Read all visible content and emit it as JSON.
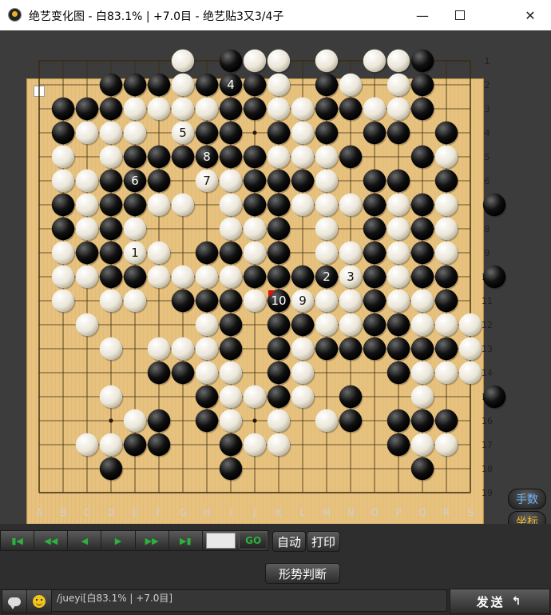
{
  "window": {
    "title": "绝艺变化图 - 白83.1% | +7.0目 - 绝艺贴3又3/4子",
    "minimize_glyph": "—",
    "close_glyph": "✕"
  },
  "board": {
    "size": 19,
    "col_labels": [
      "A",
      "B",
      "C",
      "D",
      "E",
      "F",
      "G",
      "H",
      "I",
      "J",
      "K",
      "L",
      "M",
      "N",
      "O",
      "P",
      "Q",
      "R",
      "S"
    ],
    "row_labels": [
      "1",
      "2",
      "3",
      "4",
      "5",
      "6",
      "7",
      "8",
      "9",
      "10",
      "11",
      "12",
      "13",
      "14",
      "15",
      "16",
      "17",
      "18",
      "19"
    ],
    "stones": [
      {
        "c": "w",
        "x": 6,
        "y": 0
      },
      {
        "c": "b",
        "x": 8,
        "y": 0
      },
      {
        "c": "w",
        "x": 9,
        "y": 0
      },
      {
        "c": "w",
        "x": 10,
        "y": 0
      },
      {
        "c": "w",
        "x": 12,
        "y": 0
      },
      {
        "c": "w",
        "x": 14,
        "y": 0
      },
      {
        "c": "w",
        "x": 15,
        "y": 0
      },
      {
        "c": "b",
        "x": 16,
        "y": 0
      },
      {
        "c": "b",
        "x": 3,
        "y": 1
      },
      {
        "c": "b",
        "x": 4,
        "y": 1
      },
      {
        "c": "b",
        "x": 5,
        "y": 1
      },
      {
        "c": "w",
        "x": 6,
        "y": 1
      },
      {
        "c": "b",
        "x": 7,
        "y": 1
      },
      {
        "c": "b",
        "x": 8,
        "y": 1,
        "n": "4"
      },
      {
        "c": "b",
        "x": 9,
        "y": 1
      },
      {
        "c": "w",
        "x": 10,
        "y": 1
      },
      {
        "c": "b",
        "x": 12,
        "y": 1
      },
      {
        "c": "w",
        "x": 13,
        "y": 1
      },
      {
        "c": "w",
        "x": 15,
        "y": 1
      },
      {
        "c": "b",
        "x": 16,
        "y": 1
      },
      {
        "c": "b",
        "x": 1,
        "y": 2
      },
      {
        "c": "b",
        "x": 2,
        "y": 2
      },
      {
        "c": "b",
        "x": 3,
        "y": 2
      },
      {
        "c": "w",
        "x": 4,
        "y": 2
      },
      {
        "c": "w",
        "x": 5,
        "y": 2
      },
      {
        "c": "w",
        "x": 6,
        "y": 2
      },
      {
        "c": "w",
        "x": 7,
        "y": 2
      },
      {
        "c": "b",
        "x": 8,
        "y": 2
      },
      {
        "c": "b",
        "x": 9,
        "y": 2
      },
      {
        "c": "w",
        "x": 10,
        "y": 2
      },
      {
        "c": "w",
        "x": 11,
        "y": 2
      },
      {
        "c": "b",
        "x": 12,
        "y": 2
      },
      {
        "c": "b",
        "x": 13,
        "y": 2
      },
      {
        "c": "w",
        "x": 14,
        "y": 2
      },
      {
        "c": "w",
        "x": 15,
        "y": 2
      },
      {
        "c": "b",
        "x": 16,
        "y": 2
      },
      {
        "c": "b",
        "x": 1,
        "y": 3
      },
      {
        "c": "w",
        "x": 2,
        "y": 3
      },
      {
        "c": "w",
        "x": 3,
        "y": 3
      },
      {
        "c": "w",
        "x": 4,
        "y": 3
      },
      {
        "c": "w",
        "x": 6,
        "y": 3,
        "n": "5"
      },
      {
        "c": "b",
        "x": 7,
        "y": 3
      },
      {
        "c": "b",
        "x": 8,
        "y": 3
      },
      {
        "c": "b",
        "x": 10,
        "y": 3
      },
      {
        "c": "w",
        "x": 11,
        "y": 3
      },
      {
        "c": "b",
        "x": 12,
        "y": 3
      },
      {
        "c": "b",
        "x": 14,
        "y": 3
      },
      {
        "c": "b",
        "x": 15,
        "y": 3
      },
      {
        "c": "b",
        "x": 17,
        "y": 3
      },
      {
        "c": "w",
        "x": 1,
        "y": 4
      },
      {
        "c": "w",
        "x": 3,
        "y": 4
      },
      {
        "c": "b",
        "x": 4,
        "y": 4
      },
      {
        "c": "b",
        "x": 5,
        "y": 4
      },
      {
        "c": "b",
        "x": 6,
        "y": 4
      },
      {
        "c": "b",
        "x": 7,
        "y": 4,
        "n": "8"
      },
      {
        "c": "b",
        "x": 8,
        "y": 4
      },
      {
        "c": "b",
        "x": 9,
        "y": 4
      },
      {
        "c": "w",
        "x": 10,
        "y": 4
      },
      {
        "c": "w",
        "x": 11,
        "y": 4
      },
      {
        "c": "w",
        "x": 12,
        "y": 4
      },
      {
        "c": "b",
        "x": 13,
        "y": 4
      },
      {
        "c": "b",
        "x": 16,
        "y": 4
      },
      {
        "c": "w",
        "x": 17,
        "y": 4
      },
      {
        "c": "w",
        "x": 1,
        "y": 5
      },
      {
        "c": "w",
        "x": 2,
        "y": 5
      },
      {
        "c": "b",
        "x": 3,
        "y": 5
      },
      {
        "c": "b",
        "x": 4,
        "y": 5,
        "n": "6"
      },
      {
        "c": "b",
        "x": 5,
        "y": 5
      },
      {
        "c": "w",
        "x": 7,
        "y": 5,
        "n": "7"
      },
      {
        "c": "w",
        "x": 8,
        "y": 5
      },
      {
        "c": "b",
        "x": 9,
        "y": 5
      },
      {
        "c": "b",
        "x": 10,
        "y": 5
      },
      {
        "c": "b",
        "x": 11,
        "y": 5
      },
      {
        "c": "w",
        "x": 12,
        "y": 5
      },
      {
        "c": "b",
        "x": 14,
        "y": 5
      },
      {
        "c": "b",
        "x": 15,
        "y": 5
      },
      {
        "c": "b",
        "x": 17,
        "y": 5
      },
      {
        "c": "b",
        "x": 1,
        "y": 6
      },
      {
        "c": "w",
        "x": 2,
        "y": 6
      },
      {
        "c": "b",
        "x": 3,
        "y": 6
      },
      {
        "c": "b",
        "x": 4,
        "y": 6
      },
      {
        "c": "w",
        "x": 5,
        "y": 6
      },
      {
        "c": "w",
        "x": 6,
        "y": 6
      },
      {
        "c": "w",
        "x": 8,
        "y": 6
      },
      {
        "c": "b",
        "x": 9,
        "y": 6
      },
      {
        "c": "b",
        "x": 10,
        "y": 6
      },
      {
        "c": "w",
        "x": 11,
        "y": 6
      },
      {
        "c": "w",
        "x": 12,
        "y": 6
      },
      {
        "c": "w",
        "x": 13,
        "y": 6
      },
      {
        "c": "b",
        "x": 14,
        "y": 6
      },
      {
        "c": "w",
        "x": 15,
        "y": 6
      },
      {
        "c": "b",
        "x": 16,
        "y": 6
      },
      {
        "c": "w",
        "x": 17,
        "y": 6
      },
      {
        "c": "b",
        "x": 19,
        "y": 6
      },
      {
        "c": "b",
        "x": 1,
        "y": 7
      },
      {
        "c": "w",
        "x": 2,
        "y": 7
      },
      {
        "c": "b",
        "x": 3,
        "y": 7
      },
      {
        "c": "w",
        "x": 4,
        "y": 7
      },
      {
        "c": "w",
        "x": 8,
        "y": 7
      },
      {
        "c": "w",
        "x": 9,
        "y": 7
      },
      {
        "c": "b",
        "x": 10,
        "y": 7
      },
      {
        "c": "w",
        "x": 12,
        "y": 7
      },
      {
        "c": "b",
        "x": 14,
        "y": 7
      },
      {
        "c": "w",
        "x": 15,
        "y": 7
      },
      {
        "c": "b",
        "x": 16,
        "y": 7
      },
      {
        "c": "w",
        "x": 17,
        "y": 7
      },
      {
        "c": "w",
        "x": 1,
        "y": 8
      },
      {
        "c": "b",
        "x": 2,
        "y": 8
      },
      {
        "c": "b",
        "x": 3,
        "y": 8
      },
      {
        "c": "w",
        "x": 4,
        "y": 8,
        "n": "1"
      },
      {
        "c": "w",
        "x": 5,
        "y": 8
      },
      {
        "c": "b",
        "x": 7,
        "y": 8
      },
      {
        "c": "b",
        "x": 8,
        "y": 8
      },
      {
        "c": "w",
        "x": 9,
        "y": 8
      },
      {
        "c": "b",
        "x": 10,
        "y": 8
      },
      {
        "c": "w",
        "x": 12,
        "y": 8
      },
      {
        "c": "w",
        "x": 13,
        "y": 8
      },
      {
        "c": "b",
        "x": 14,
        "y": 8
      },
      {
        "c": "w",
        "x": 15,
        "y": 8
      },
      {
        "c": "b",
        "x": 16,
        "y": 8
      },
      {
        "c": "w",
        "x": 17,
        "y": 8
      },
      {
        "c": "w",
        "x": 1,
        "y": 9
      },
      {
        "c": "w",
        "x": 2,
        "y": 9
      },
      {
        "c": "b",
        "x": 3,
        "y": 9
      },
      {
        "c": "b",
        "x": 4,
        "y": 9
      },
      {
        "c": "w",
        "x": 5,
        "y": 9
      },
      {
        "c": "w",
        "x": 6,
        "y": 9
      },
      {
        "c": "w",
        "x": 7,
        "y": 9
      },
      {
        "c": "w",
        "x": 8,
        "y": 9
      },
      {
        "c": "b",
        "x": 9,
        "y": 9
      },
      {
        "c": "b",
        "x": 10,
        "y": 9
      },
      {
        "c": "b",
        "x": 11,
        "y": 9
      },
      {
        "c": "b",
        "x": 12,
        "y": 9,
        "n": "2"
      },
      {
        "c": "w",
        "x": 13,
        "y": 9,
        "n": "3"
      },
      {
        "c": "b",
        "x": 14,
        "y": 9
      },
      {
        "c": "w",
        "x": 15,
        "y": 9
      },
      {
        "c": "b",
        "x": 16,
        "y": 9
      },
      {
        "c": "b",
        "x": 17,
        "y": 9
      },
      {
        "c": "b",
        "x": 19,
        "y": 9
      },
      {
        "c": "w",
        "x": 1,
        "y": 10
      },
      {
        "c": "w",
        "x": 3,
        "y": 10
      },
      {
        "c": "w",
        "x": 4,
        "y": 10
      },
      {
        "c": "b",
        "x": 6,
        "y": 10
      },
      {
        "c": "b",
        "x": 7,
        "y": 10
      },
      {
        "c": "b",
        "x": 8,
        "y": 10
      },
      {
        "c": "w",
        "x": 9,
        "y": 10
      },
      {
        "c": "b",
        "x": 10,
        "y": 10,
        "n": "10",
        "last": true
      },
      {
        "c": "w",
        "x": 11,
        "y": 10,
        "n": "9"
      },
      {
        "c": "w",
        "x": 12,
        "y": 10
      },
      {
        "c": "w",
        "x": 13,
        "y": 10
      },
      {
        "c": "b",
        "x": 14,
        "y": 10
      },
      {
        "c": "w",
        "x": 15,
        "y": 10
      },
      {
        "c": "w",
        "x": 16,
        "y": 10
      },
      {
        "c": "b",
        "x": 17,
        "y": 10
      },
      {
        "c": "w",
        "x": 2,
        "y": 11
      },
      {
        "c": "w",
        "x": 7,
        "y": 11
      },
      {
        "c": "b",
        "x": 8,
        "y": 11
      },
      {
        "c": "b",
        "x": 10,
        "y": 11
      },
      {
        "c": "b",
        "x": 11,
        "y": 11
      },
      {
        "c": "w",
        "x": 12,
        "y": 11
      },
      {
        "c": "w",
        "x": 13,
        "y": 11
      },
      {
        "c": "b",
        "x": 14,
        "y": 11
      },
      {
        "c": "b",
        "x": 15,
        "y": 11
      },
      {
        "c": "w",
        "x": 16,
        "y": 11
      },
      {
        "c": "w",
        "x": 17,
        "y": 11
      },
      {
        "c": "w",
        "x": 18,
        "y": 11
      },
      {
        "c": "w",
        "x": 3,
        "y": 12
      },
      {
        "c": "w",
        "x": 5,
        "y": 12
      },
      {
        "c": "w",
        "x": 6,
        "y": 12
      },
      {
        "c": "w",
        "x": 7,
        "y": 12
      },
      {
        "c": "b",
        "x": 8,
        "y": 12
      },
      {
        "c": "b",
        "x": 10,
        "y": 12
      },
      {
        "c": "w",
        "x": 11,
        "y": 12
      },
      {
        "c": "b",
        "x": 12,
        "y": 12
      },
      {
        "c": "b",
        "x": 13,
        "y": 12
      },
      {
        "c": "b",
        "x": 14,
        "y": 12
      },
      {
        "c": "b",
        "x": 15,
        "y": 12
      },
      {
        "c": "b",
        "x": 16,
        "y": 12
      },
      {
        "c": "b",
        "x": 17,
        "y": 12
      },
      {
        "c": "w",
        "x": 18,
        "y": 12
      },
      {
        "c": "b",
        "x": 5,
        "y": 13
      },
      {
        "c": "b",
        "x": 6,
        "y": 13
      },
      {
        "c": "w",
        "x": 7,
        "y": 13
      },
      {
        "c": "w",
        "x": 8,
        "y": 13
      },
      {
        "c": "b",
        "x": 10,
        "y": 13
      },
      {
        "c": "w",
        "x": 11,
        "y": 13
      },
      {
        "c": "b",
        "x": 15,
        "y": 13
      },
      {
        "c": "w",
        "x": 16,
        "y": 13
      },
      {
        "c": "w",
        "x": 17,
        "y": 13
      },
      {
        "c": "w",
        "x": 18,
        "y": 13
      },
      {
        "c": "w",
        "x": 3,
        "y": 14
      },
      {
        "c": "b",
        "x": 7,
        "y": 14
      },
      {
        "c": "w",
        "x": 8,
        "y": 14
      },
      {
        "c": "w",
        "x": 9,
        "y": 14
      },
      {
        "c": "b",
        "x": 10,
        "y": 14
      },
      {
        "c": "w",
        "x": 11,
        "y": 14
      },
      {
        "c": "b",
        "x": 13,
        "y": 14
      },
      {
        "c": "w",
        "x": 16,
        "y": 14
      },
      {
        "c": "b",
        "x": 19,
        "y": 14
      },
      {
        "c": "w",
        "x": 4,
        "y": 15
      },
      {
        "c": "b",
        "x": 5,
        "y": 15
      },
      {
        "c": "b",
        "x": 7,
        "y": 15
      },
      {
        "c": "w",
        "x": 8,
        "y": 15
      },
      {
        "c": "w",
        "x": 10,
        "y": 15
      },
      {
        "c": "w",
        "x": 12,
        "y": 15
      },
      {
        "c": "b",
        "x": 13,
        "y": 15
      },
      {
        "c": "b",
        "x": 15,
        "y": 15
      },
      {
        "c": "b",
        "x": 16,
        "y": 15
      },
      {
        "c": "b",
        "x": 17,
        "y": 15
      },
      {
        "c": "w",
        "x": 2,
        "y": 16
      },
      {
        "c": "w",
        "x": 3,
        "y": 16
      },
      {
        "c": "b",
        "x": 4,
        "y": 16
      },
      {
        "c": "b",
        "x": 5,
        "y": 16
      },
      {
        "c": "b",
        "x": 8,
        "y": 16
      },
      {
        "c": "w",
        "x": 9,
        "y": 16
      },
      {
        "c": "w",
        "x": 10,
        "y": 16
      },
      {
        "c": "b",
        "x": 15,
        "y": 16
      },
      {
        "c": "w",
        "x": 16,
        "y": 16
      },
      {
        "c": "w",
        "x": 17,
        "y": 16
      },
      {
        "c": "b",
        "x": 3,
        "y": 17
      },
      {
        "c": "b",
        "x": 8,
        "y": 17
      },
      {
        "c": "b",
        "x": 16,
        "y": 17
      }
    ]
  },
  "side_buttons": {
    "moves_label": "手数",
    "coords_label": "坐标"
  },
  "navigation": {
    "first_glyph": "▮◀",
    "fast_back_glyph": "◀◀",
    "back_glyph": "◀",
    "forward_glyph": "▶",
    "fast_forward_glyph": "▶▶",
    "last_glyph": "▶▮",
    "move_input_value": "",
    "go_label": "GO"
  },
  "buttons": {
    "auto_label": "自动",
    "print_label": "打印",
    "situation_label": "形势判断"
  },
  "chat": {
    "message": "/jueyi[白83.1% | +7.0目]",
    "send_label": "发送",
    "send_icon": "↰"
  }
}
